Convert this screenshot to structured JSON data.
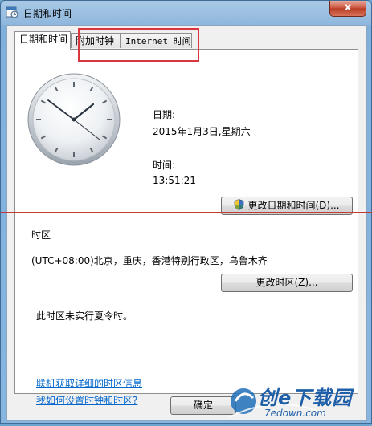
{
  "window": {
    "title": "日期和时间",
    "close_label": "x"
  },
  "tabs": [
    {
      "label": "日期和时间",
      "active": true
    },
    {
      "label": "附加时钟",
      "active": false
    },
    {
      "label": "Internet 时间",
      "active": false
    }
  ],
  "datetime": {
    "date_label": "日期:",
    "date_value": "2015年1月3日,星期六",
    "time_label": "时间:",
    "time_value": "13:51:21",
    "change_button": "更改日期和时间(D)..."
  },
  "timezone": {
    "group_label": "时区",
    "value": "(UTC+08:00)北京，重庆，香港特别行政区，乌鲁木齐",
    "change_button": "更改时区(Z)...",
    "dst_note": "此时区未实行夏令时。"
  },
  "links": {
    "online_info": "联机获取详细的时区信息",
    "how_to": "我如何设置时钟和时区?"
  },
  "footer": {
    "ok_button": "确定"
  },
  "watermark": {
    "brand": "创e下载园",
    "domain": "7edown.com"
  },
  "colors": {
    "highlight": "#d9363e",
    "link": "#0066cc"
  }
}
